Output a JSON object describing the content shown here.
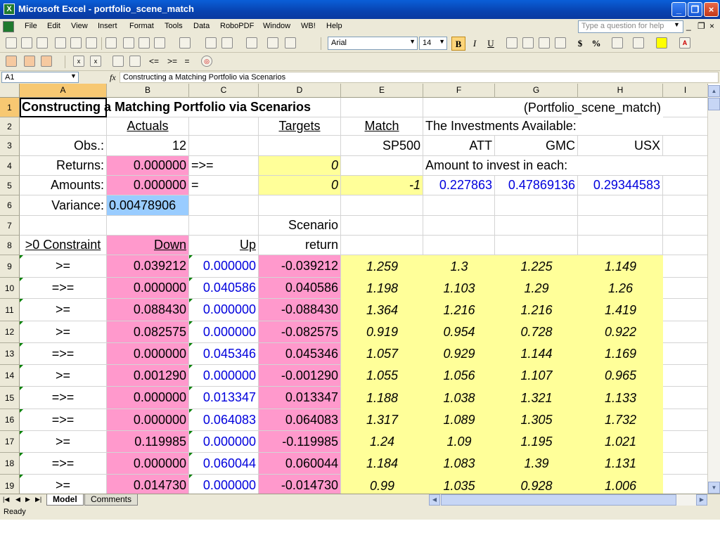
{
  "window": {
    "app_icon": "X",
    "title": "Microsoft Excel - portfolio_scene_match",
    "minimize_icon": "minimize-icon",
    "restore_icon": "restore-icon",
    "close_icon": "close-icon"
  },
  "menu": {
    "items": [
      "File",
      "Edit",
      "View",
      "Insert",
      "Format",
      "Tools",
      "Data",
      "RoboPDF",
      "Window",
      "WB!",
      "Help"
    ],
    "help_placeholder": "Type a question for help",
    "mdi_minimize": "_",
    "mdi_restore": "❐",
    "mdi_close": "×"
  },
  "toolbar": {
    "font_name": "Arial",
    "font_size": "14",
    "bold": "B",
    "italic": "I",
    "underline": "U",
    "currency": "$",
    "percent": "%",
    "row2_ops": [
      "<=",
      ">=",
      "="
    ]
  },
  "formula_bar": {
    "name_box": "A1",
    "fx": "fx",
    "formula": "Constructing a Matching Portfolio via Scenarios"
  },
  "sheet": {
    "columns": [
      "A",
      "B",
      "C",
      "D",
      "E",
      "F",
      "G",
      "H",
      "I"
    ],
    "rows": [
      "1",
      "2",
      "3",
      "4",
      "5",
      "6",
      "7",
      "8",
      "9",
      "10",
      "11",
      "12",
      "13",
      "14",
      "15",
      "16",
      "17",
      "18",
      "19"
    ],
    "r1": {
      "title": "Constructing a Matching Portfolio via Scenarios",
      "tag": "(Portfolio_scene_match)"
    },
    "r2": {
      "actuals": "Actuals",
      "targets": "Targets",
      "match": "Match",
      "investments": "The Investments Available:"
    },
    "r3": {
      "obs_label": "Obs.:",
      "obs": "12",
      "sp500": "SP500",
      "att": "ATT",
      "gmc": "GMC",
      "usx": "USX"
    },
    "r4": {
      "label": "Returns:",
      "actual": "0.000000",
      "op": "=>=",
      "target": "0",
      "invest_label": "Amount to invest in each:"
    },
    "r5": {
      "label": "Amounts:",
      "actual": "0.000000",
      "op": "=",
      "target": "0",
      "match": "-1",
      "att": "0.227863",
      "gmc": "0.47869136",
      "usx": "0.29344583"
    },
    "r6": {
      "label": "Variance:",
      "value": "0.00478906"
    },
    "r7": {
      "scenario": "Scenario"
    },
    "r8": {
      "constraint": ">0 Constraint",
      "down": "Down",
      "up": "Up",
      "return": "return"
    },
    "scenarios": [
      {
        "op": ">=",
        "down": "0.039212",
        "up": "0.000000",
        "ret": "-0.039212",
        "sp500": "1.259",
        "att": "1.3",
        "gmc": "1.225",
        "usx": "1.149"
      },
      {
        "op": "=>=",
        "down": "0.000000",
        "up": "0.040586",
        "ret": "0.040586",
        "sp500": "1.198",
        "att": "1.103",
        "gmc": "1.29",
        "usx": "1.26"
      },
      {
        "op": ">=",
        "down": "0.088430",
        "up": "0.000000",
        "ret": "-0.088430",
        "sp500": "1.364",
        "att": "1.216",
        "gmc": "1.216",
        "usx": "1.419"
      },
      {
        "op": ">=",
        "down": "0.082575",
        "up": "0.000000",
        "ret": "-0.082575",
        "sp500": "0.919",
        "att": "0.954",
        "gmc": "0.728",
        "usx": "0.922"
      },
      {
        "op": "=>=",
        "down": "0.000000",
        "up": "0.045346",
        "ret": "0.045346",
        "sp500": "1.057",
        "att": "0.929",
        "gmc": "1.144",
        "usx": "1.169"
      },
      {
        "op": ">=",
        "down": "0.001290",
        "up": "0.000000",
        "ret": "-0.001290",
        "sp500": "1.055",
        "att": "1.056",
        "gmc": "1.107",
        "usx": "0.965"
      },
      {
        "op": "=>=",
        "down": "0.000000",
        "up": "0.013347",
        "ret": "0.013347",
        "sp500": "1.188",
        "att": "1.038",
        "gmc": "1.321",
        "usx": "1.133"
      },
      {
        "op": "=>=",
        "down": "0.000000",
        "up": "0.064083",
        "ret": "0.064083",
        "sp500": "1.317",
        "att": "1.089",
        "gmc": "1.305",
        "usx": "1.732"
      },
      {
        "op": ">=",
        "down": "0.119985",
        "up": "0.000000",
        "ret": "-0.119985",
        "sp500": "1.24",
        "att": "1.09",
        "gmc": "1.195",
        "usx": "1.021"
      },
      {
        "op": "=>=",
        "down": "0.000000",
        "up": "0.060044",
        "ret": "0.060044",
        "sp500": "1.184",
        "att": "1.083",
        "gmc": "1.39",
        "usx": "1.131"
      },
      {
        "op": ">=",
        "down": "0.014730",
        "up": "0.000000",
        "ret": "-0.014730",
        "sp500": "0.99",
        "att": "1.035",
        "gmc": "0.928",
        "usx": "1.006"
      }
    ]
  },
  "tabs": [
    "Model",
    "Comments"
  ],
  "status": "Ready",
  "colors": {
    "pink": "#ff99cc",
    "yellow": "#ffff99",
    "light_blue": "#99ccff",
    "blue_text": "#0000dd"
  }
}
